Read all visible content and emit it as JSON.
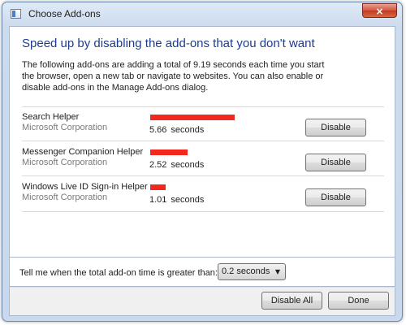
{
  "window": {
    "title": "Choose Add-ons",
    "close_glyph": "×"
  },
  "heading": "Speed up by disabling the add-ons that you don't want",
  "description": "The following add-ons are adding a total of 9.19 seconds each time you start the browser, open a new tab or navigate to websites. You can also enable or disable add-ons in the Manage Add-ons dialog.",
  "addons": [
    {
      "name": "Search Helper",
      "publisher": "Microsoft Corporation",
      "time": "5.66",
      "unit": "seconds",
      "action": "Disable"
    },
    {
      "name": "Messenger Companion Helper",
      "publisher": "Microsoft Corporation",
      "time": "2.52",
      "unit": "seconds",
      "action": "Disable"
    },
    {
      "name": "Windows Live ID Sign-in Helper",
      "publisher": "Microsoft Corporation",
      "time": "1.01",
      "unit": "seconds",
      "action": "Disable"
    }
  ],
  "threshold": {
    "label": "Tell me when the total add-on time is greater than:",
    "selected": "0.2 seconds"
  },
  "footer": {
    "disable_all": "Disable All",
    "done": "Done"
  },
  "colors": {
    "bar": "#f0281e",
    "heading": "#1e3c8c"
  },
  "icons": {
    "app": "window-icon",
    "close": "close-icon",
    "dropdown": "chevron-down-icon"
  }
}
